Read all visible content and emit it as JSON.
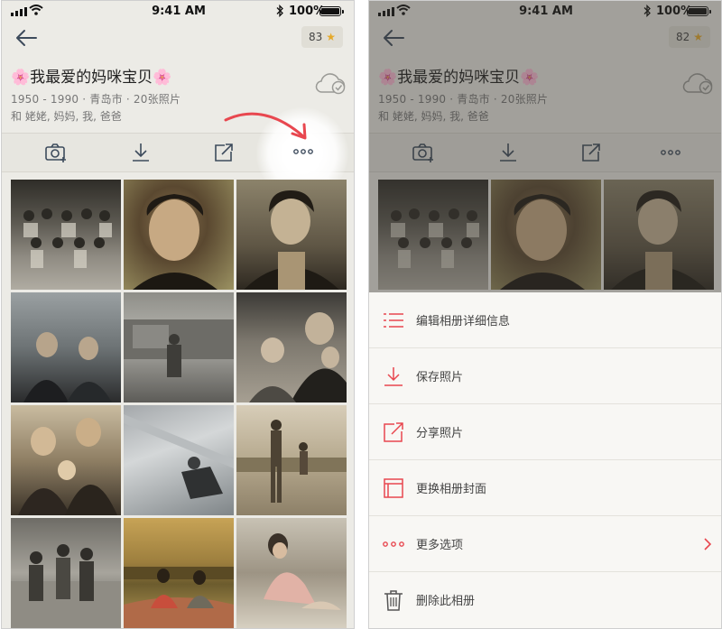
{
  "status_bar": {
    "time": "9:41 AM",
    "battery": "100%"
  },
  "screen_left": {
    "score": "83",
    "album": {
      "title": "🌸我最爱的妈咪宝贝🌸",
      "meta": "1950 - 1990 · 青岛市 · 20张照片",
      "people": "和 姥姥, 妈妈, 我, 爸爸"
    }
  },
  "screen_right": {
    "score": "82",
    "album": {
      "title": "🌸我最爱的妈咪宝贝🌸",
      "meta": "1950 - 1990 · 青岛市 · 20张照片",
      "people": "和 姥姥, 妈妈, 我, 爸爸"
    },
    "menu": [
      {
        "label": "编辑相册详细信息",
        "icon": "list-icon"
      },
      {
        "label": "保存照片",
        "icon": "download-icon"
      },
      {
        "label": "分享照片",
        "icon": "share-icon"
      },
      {
        "label": "更换相册封面",
        "icon": "cover-icon"
      },
      {
        "label": "更多选项",
        "icon": "more-dots-icon"
      },
      {
        "label": "删除此相册",
        "icon": "trash-icon"
      }
    ]
  },
  "colors": {
    "accent": "#e8474f",
    "icon_dark": "#3d4b5c",
    "star": "#e5a92a",
    "background": "#ecebe6"
  }
}
